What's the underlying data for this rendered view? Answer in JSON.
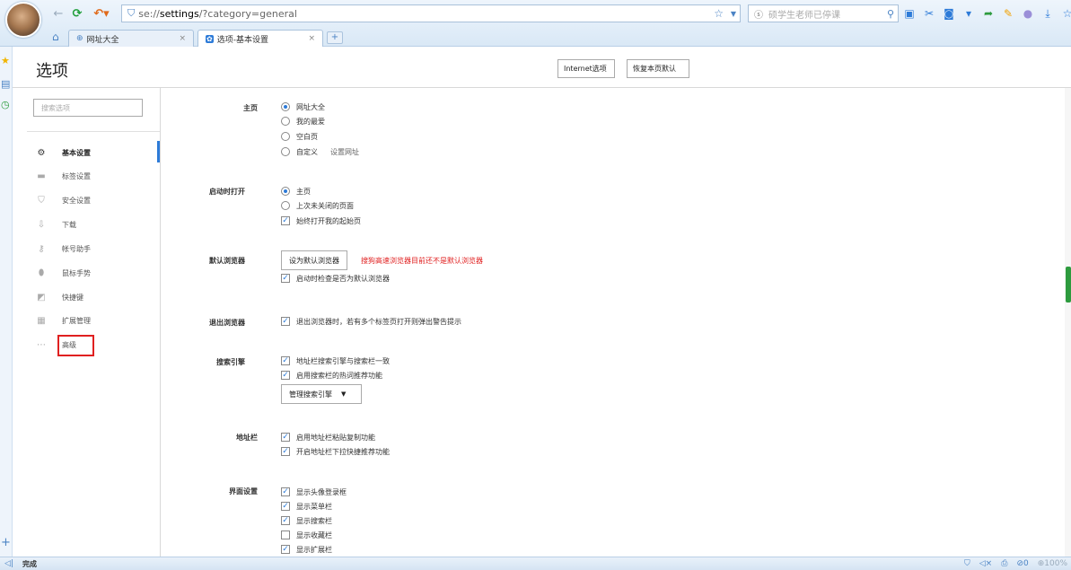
{
  "browser": {
    "url_scheme": "se://",
    "url_host": "settings",
    "url_path": "/?category=general",
    "search_placeholder": "硕学生老师已停课"
  },
  "tabs": [
    {
      "label": "网址大全",
      "close": "×"
    },
    {
      "label": "选项-基本设置",
      "close": "×"
    }
  ],
  "new_tab_label": "+",
  "page": {
    "title": "选项",
    "internet_options_label": "Internet选项",
    "restore_defaults_label": "恢复本页默认"
  },
  "sidebar": {
    "search_placeholder": "搜索选项",
    "items": [
      {
        "label": "基本设置",
        "icon": "gear-icon"
      },
      {
        "label": "标签设置",
        "icon": "tab-icon"
      },
      {
        "label": "安全设置",
        "icon": "shield-icon"
      },
      {
        "label": "下载",
        "icon": "download-icon"
      },
      {
        "label": "帐号助手",
        "icon": "key-icon"
      },
      {
        "label": "鼠标手势",
        "icon": "mouse-icon"
      },
      {
        "label": "快捷键",
        "icon": "shortcut-icon"
      },
      {
        "label": "扩展管理",
        "icon": "grid-icon"
      },
      {
        "label": "高级",
        "icon": "more-icon"
      }
    ]
  },
  "sections": {
    "homepage": {
      "label": "主页",
      "options": [
        "网址大全",
        "我的最爱",
        "空白页",
        "自定义"
      ],
      "set_url_link": "设置网址"
    },
    "startup": {
      "label": "启动时打开",
      "options": [
        "主页",
        "上次未关闭的页面"
      ],
      "always_open_start_page": "始终打开我的起始页"
    },
    "default_browser": {
      "label": "默认浏览器",
      "button": "设为默认浏览器",
      "warning": "搜狗高速浏览器目前还不是默认浏览器",
      "check_on_startup": "启动时检查是否为默认浏览器"
    },
    "exit_browser": {
      "label": "退出浏览器",
      "warn_on_close": "退出浏览器时，若有多个标签页打开则弹出警告提示"
    },
    "search_engine": {
      "label": "搜索引擎",
      "sync_with_address_bar": "地址栏搜索引擎与搜索栏一致",
      "hot_words": "启用搜索栏的热词推荐功能",
      "manage_button": "管理搜索引擎"
    },
    "address_bar": {
      "label": "地址栏",
      "paste_copy": "启用地址栏粘贴复制功能",
      "dropdown_recommend": "开启地址栏下拉快捷推荐功能"
    },
    "interface": {
      "label": "界面设置",
      "items": [
        {
          "label": "显示头像登录框",
          "checked": true
        },
        {
          "label": "显示菜单栏",
          "checked": true
        },
        {
          "label": "显示搜索栏",
          "checked": true
        },
        {
          "label": "显示收藏栏",
          "checked": false
        },
        {
          "label": "显示扩展栏",
          "checked": true
        }
      ]
    }
  },
  "status": {
    "text": "完成",
    "counter": "0",
    "zoom": "100%"
  },
  "colors": {
    "accent": "#2d7bd8",
    "warning": "#e02020",
    "highlight_box": "#e02020"
  }
}
